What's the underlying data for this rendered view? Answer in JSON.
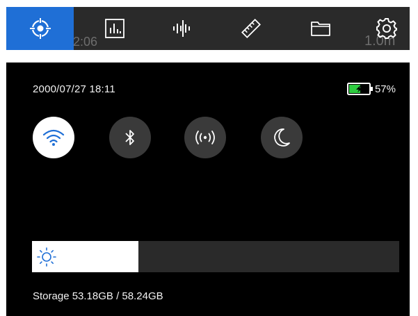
{
  "toolbar": {
    "items": [
      {
        "icon": "target-icon",
        "active": true
      },
      {
        "icon": "bar-chart-icon",
        "active": false
      },
      {
        "icon": "waveform-icon",
        "active": false
      },
      {
        "icon": "ruler-icon",
        "active": false
      },
      {
        "icon": "folder-icon",
        "active": false
      },
      {
        "icon": "gear-icon",
        "active": false
      }
    ],
    "ghost_left": "2:06",
    "ghost_right": "1.0m",
    "active_color": "#1f6fd6"
  },
  "status": {
    "datetime": "2000/07/27 18:11",
    "battery_percent": "57%",
    "battery_level": 0.57,
    "battery_color": "#2ecc40"
  },
  "toggles": [
    {
      "name": "wifi",
      "icon": "wifi-icon",
      "on": true
    },
    {
      "name": "bluetooth",
      "icon": "bluetooth-icon",
      "on": false
    },
    {
      "name": "hotspot",
      "icon": "hotspot-icon",
      "on": false
    },
    {
      "name": "night-mode",
      "icon": "moon-icon",
      "on": false
    }
  ],
  "brightness": {
    "icon": "sun-icon",
    "level": 0.29
  },
  "storage": {
    "text": "Storage 53.18GB / 58.24GB"
  }
}
